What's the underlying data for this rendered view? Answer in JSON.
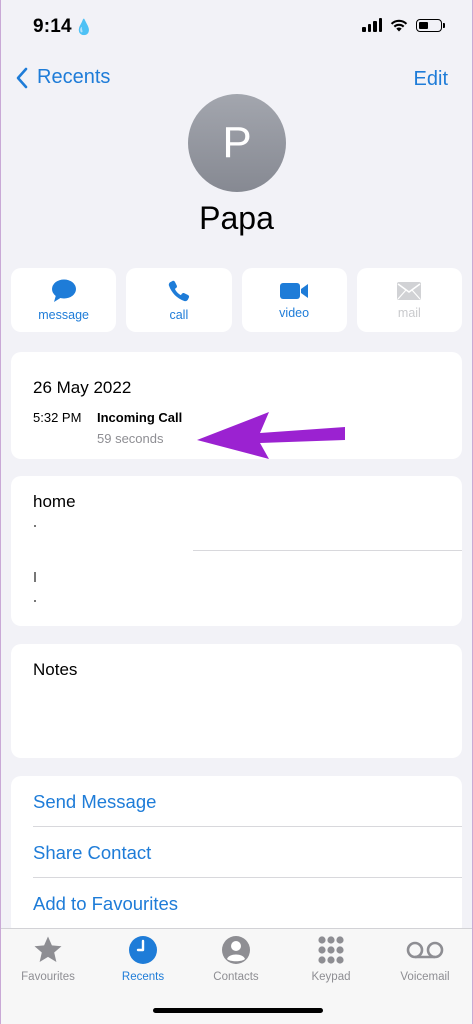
{
  "status": {
    "time": "9:14"
  },
  "nav": {
    "back_label": "Recents",
    "edit_label": "Edit"
  },
  "contact": {
    "initial": "P",
    "name": "Papa"
  },
  "actions": [
    {
      "label": "message",
      "icon": "message-icon",
      "enabled": true
    },
    {
      "label": "call",
      "icon": "phone-icon",
      "enabled": true
    },
    {
      "label": "video",
      "icon": "video-icon",
      "enabled": true
    },
    {
      "label": "mail",
      "icon": "mail-icon",
      "enabled": false
    }
  ],
  "call_log": {
    "date": "26 May 2022",
    "time": "5:32 PM",
    "type": "Incoming Call",
    "duration": "59 seconds"
  },
  "phone": {
    "label": "home"
  },
  "notes": {
    "label": "Notes"
  },
  "links": [
    {
      "label": "Send Message"
    },
    {
      "label": "Share Contact"
    },
    {
      "label": "Add to Favourites"
    }
  ],
  "tabs": [
    {
      "label": "Favourites",
      "icon": "star-icon",
      "active": false
    },
    {
      "label": "Recents",
      "icon": "clock-icon",
      "active": true
    },
    {
      "label": "Contacts",
      "icon": "person-icon",
      "active": false
    },
    {
      "label": "Keypad",
      "icon": "keypad-icon",
      "active": false
    },
    {
      "label": "Voicemail",
      "icon": "voicemail-icon",
      "active": false
    }
  ],
  "colors": {
    "accent": "#1e7cd8",
    "annotation_arrow": "#9b22d1",
    "background": "#f2f2f7"
  }
}
